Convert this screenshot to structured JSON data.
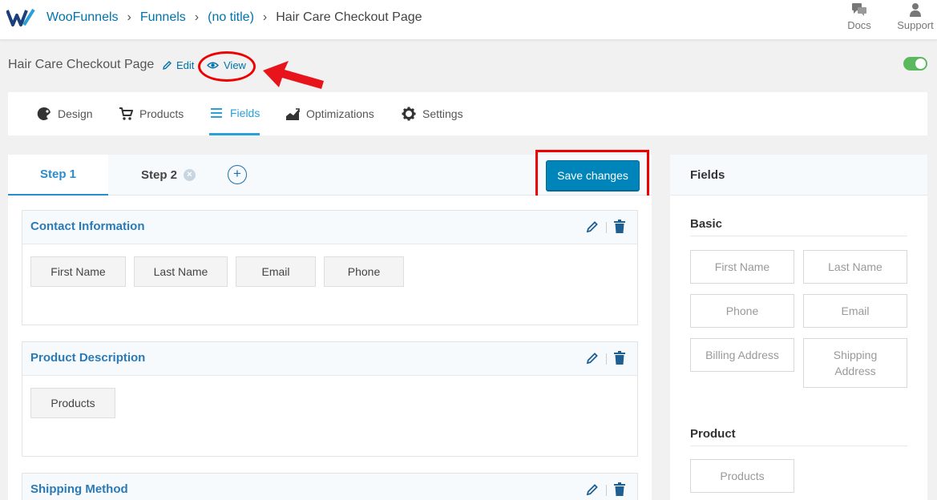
{
  "breadcrumb": {
    "root": "WooFunnels",
    "funnels": "Funnels",
    "funnel": "(no title)",
    "page": "Hair Care Checkout Page"
  },
  "topbar": {
    "docs": "Docs",
    "support": "Support"
  },
  "title_row": {
    "title": "Hair Care Checkout Page",
    "edit": "Edit",
    "view": "View",
    "enabled": true
  },
  "tabs": [
    {
      "label": "Design",
      "icon": "palette-icon"
    },
    {
      "label": "Products",
      "icon": "cart-icon"
    },
    {
      "label": "Fields",
      "icon": "list-icon",
      "active": true
    },
    {
      "label": "Optimizations",
      "icon": "chart-icon"
    },
    {
      "label": "Settings",
      "icon": "gear-icon"
    }
  ],
  "steps": {
    "step1": "Step 1",
    "step2": "Step 2",
    "add": "+"
  },
  "save_label": "Save changes",
  "sections": [
    {
      "title": "Contact Information",
      "fields": [
        "First Name",
        "Last Name",
        "Email",
        "Phone"
      ]
    },
    {
      "title": "Product Description",
      "fields": [
        "Products"
      ]
    },
    {
      "title": "Shipping Method",
      "fields": []
    }
  ],
  "fields_panel": {
    "title": "Fields",
    "basic_title": "Basic",
    "basic": [
      "First Name",
      "Last Name",
      "Phone",
      "Email",
      "Billing Address",
      "Shipping Address"
    ],
    "product_title": "Product",
    "product": [
      "Products"
    ]
  },
  "colors": {
    "accent": "#0085ba",
    "link": "#0073aa",
    "annotation": "#e00000",
    "toggle": "#5cb85c"
  }
}
